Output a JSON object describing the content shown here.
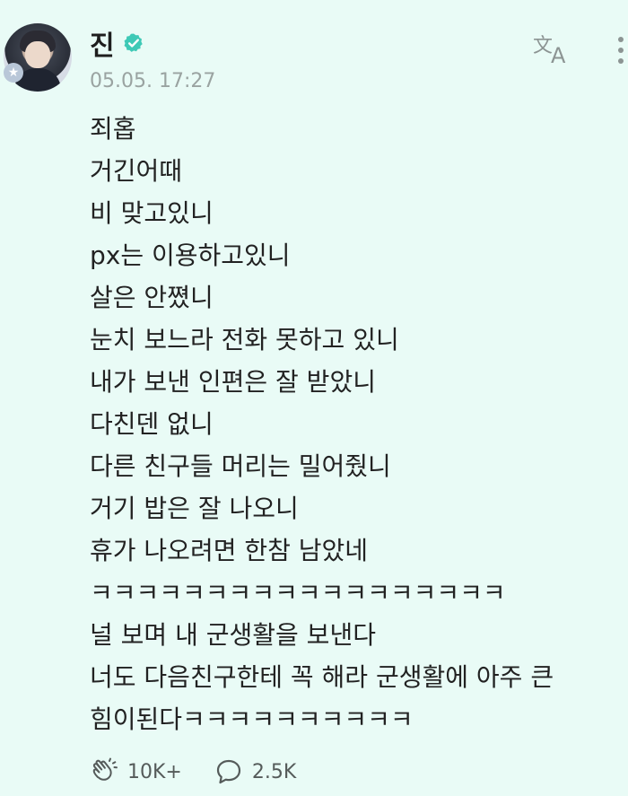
{
  "post": {
    "author": "진",
    "timestamp": "05.05. 17:27",
    "lines": [
      "죄홉",
      "거긴어때",
      "비 맞고있니",
      "px는 이용하고있니",
      "살은 안쪘니",
      "눈치 보느라 전화 못하고 있니",
      "내가 보낸 인편은 잘 받았니",
      "다친덴 없니",
      "다른 친구들 머리는 밀어줬니",
      "거기 밥은 잘 나오니",
      "휴가 나오려면 한참 남았네",
      "ㅋㅋㅋㅋㅋㅋㅋㅋㅋㅋㅋㅋㅋㅋㅋㅋㅋㅋ",
      "널 보며 내 군생활을 보낸다",
      "너도 다음친구한테 꼭 해라 군생활에 아주 큰",
      "힘이된다ㅋㅋㅋㅋㅋㅋㅋㅋㅋㅋ"
    ],
    "like_count": "10K+",
    "comment_count": "2.5K"
  },
  "icons": {
    "verified": "verified-check-icon",
    "translate": "translate-icon",
    "more": "more-vertical-icon",
    "like": "applause-hands-icon",
    "comment": "speech-bubble-icon",
    "avatar_badge": "star-badge-icon"
  },
  "colors": {
    "background": "#e9fbf6",
    "verified": "#3ec9b6",
    "text": "#222222",
    "muted": "#9aa3a1"
  }
}
